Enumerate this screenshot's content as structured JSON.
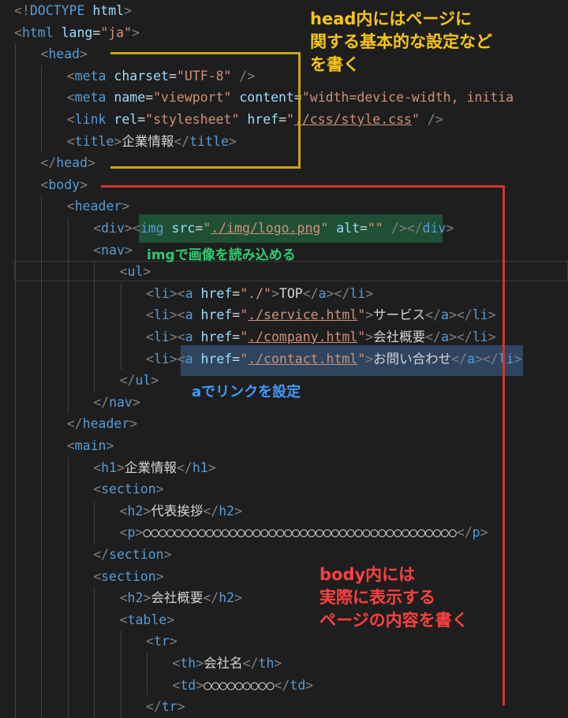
{
  "lines": [
    {
      "indent": 0,
      "tokens": [
        {
          "t": "<!",
          "c": "punct"
        },
        {
          "t": "DOCTYPE",
          "c": "kw"
        },
        {
          "t": " html",
          "c": "attr"
        },
        {
          "t": ">",
          "c": "punct"
        }
      ]
    },
    {
      "indent": 0,
      "tokens": [
        {
          "t": "<",
          "c": "punct"
        },
        {
          "t": "html",
          "c": "tag"
        },
        {
          "t": " lang",
          "c": "attr"
        },
        {
          "t": "=",
          "c": "txt"
        },
        {
          "t": "\"ja\"",
          "c": "str"
        },
        {
          "t": ">",
          "c": "punct"
        }
      ]
    },
    {
      "indent": 1,
      "tokens": [
        {
          "t": "<",
          "c": "punct"
        },
        {
          "t": "head",
          "c": "tag"
        },
        {
          "t": ">",
          "c": "punct"
        }
      ]
    },
    {
      "indent": 2,
      "tokens": [
        {
          "t": "<",
          "c": "punct"
        },
        {
          "t": "meta",
          "c": "tag"
        },
        {
          "t": " charset",
          "c": "attr"
        },
        {
          "t": "=",
          "c": "txt"
        },
        {
          "t": "\"UTF-8\"",
          "c": "str"
        },
        {
          "t": " />",
          "c": "punct"
        }
      ]
    },
    {
      "indent": 2,
      "tokens": [
        {
          "t": "<",
          "c": "punct"
        },
        {
          "t": "meta",
          "c": "tag"
        },
        {
          "t": " name",
          "c": "attr"
        },
        {
          "t": "=",
          "c": "txt"
        },
        {
          "t": "\"viewport\"",
          "c": "str"
        },
        {
          "t": " content",
          "c": "attr"
        },
        {
          "t": "=",
          "c": "txt"
        },
        {
          "t": "\"width=device-width, initia",
          "c": "str"
        }
      ]
    },
    {
      "indent": 2,
      "tokens": [
        {
          "t": "<",
          "c": "punct"
        },
        {
          "t": "link",
          "c": "tag"
        },
        {
          "t": " rel",
          "c": "attr"
        },
        {
          "t": "=",
          "c": "txt"
        },
        {
          "t": "\"stylesheet\"",
          "c": "str"
        },
        {
          "t": " href",
          "c": "attr"
        },
        {
          "t": "=",
          "c": "txt"
        },
        {
          "t": "\"",
          "c": "str"
        },
        {
          "t": "./css/style.css",
          "c": "url"
        },
        {
          "t": "\"",
          "c": "str"
        },
        {
          "t": " />",
          "c": "punct"
        }
      ]
    },
    {
      "indent": 2,
      "tokens": [
        {
          "t": "<",
          "c": "punct"
        },
        {
          "t": "title",
          "c": "tag"
        },
        {
          "t": ">",
          "c": "punct"
        },
        {
          "t": "企業情報",
          "c": "txt"
        },
        {
          "t": "</",
          "c": "punct"
        },
        {
          "t": "title",
          "c": "tag"
        },
        {
          "t": ">",
          "c": "punct"
        }
      ]
    },
    {
      "indent": 1,
      "tokens": [
        {
          "t": "</",
          "c": "punct"
        },
        {
          "t": "head",
          "c": "tag"
        },
        {
          "t": ">",
          "c": "punct"
        }
      ]
    },
    {
      "indent": 1,
      "tokens": [
        {
          "t": "<",
          "c": "punct"
        },
        {
          "t": "body",
          "c": "tag"
        },
        {
          "t": ">",
          "c": "punct"
        }
      ]
    },
    {
      "indent": 2,
      "tokens": [
        {
          "t": "<",
          "c": "punct"
        },
        {
          "t": "header",
          "c": "tag"
        },
        {
          "t": ">",
          "c": "punct"
        }
      ]
    },
    {
      "indent": 3,
      "tokens": [
        {
          "t": "<",
          "c": "punct"
        },
        {
          "t": "div",
          "c": "tag"
        },
        {
          "t": ">",
          "c": "punct"
        },
        {
          "t": "<",
          "c": "punct"
        },
        {
          "t": "img",
          "c": "tag"
        },
        {
          "t": " src",
          "c": "attr"
        },
        {
          "t": "=",
          "c": "txt"
        },
        {
          "t": "\"",
          "c": "str"
        },
        {
          "t": "./img/logo.png",
          "c": "url"
        },
        {
          "t": "\"",
          "c": "str"
        },
        {
          "t": " alt",
          "c": "attr"
        },
        {
          "t": "=",
          "c": "txt"
        },
        {
          "t": "\"\"",
          "c": "str"
        },
        {
          "t": " />",
          "c": "punct"
        },
        {
          "t": "</",
          "c": "punct"
        },
        {
          "t": "div",
          "c": "tag"
        },
        {
          "t": ">",
          "c": "punct"
        }
      ]
    },
    {
      "indent": 3,
      "tokens": [
        {
          "t": "<",
          "c": "punct"
        },
        {
          "t": "nav",
          "c": "tag"
        },
        {
          "t": ">",
          "c": "punct"
        }
      ]
    },
    {
      "indent": 4,
      "tokens": [
        {
          "t": "<",
          "c": "punct"
        },
        {
          "t": "ul",
          "c": "tag"
        },
        {
          "t": ">",
          "c": "punct"
        }
      ]
    },
    {
      "indent": 5,
      "tokens": [
        {
          "t": "<",
          "c": "punct"
        },
        {
          "t": "li",
          "c": "tag"
        },
        {
          "t": ">",
          "c": "punct"
        },
        {
          "t": "<",
          "c": "punct"
        },
        {
          "t": "a",
          "c": "tag"
        },
        {
          "t": " href",
          "c": "attr"
        },
        {
          "t": "=",
          "c": "txt"
        },
        {
          "t": "\"./\"",
          "c": "str"
        },
        {
          "t": ">",
          "c": "punct"
        },
        {
          "t": "TOP",
          "c": "txt"
        },
        {
          "t": "</",
          "c": "punct"
        },
        {
          "t": "a",
          "c": "tag"
        },
        {
          "t": ">",
          "c": "punct"
        },
        {
          "t": "</",
          "c": "punct"
        },
        {
          "t": "li",
          "c": "tag"
        },
        {
          "t": ">",
          "c": "punct"
        }
      ]
    },
    {
      "indent": 5,
      "tokens": [
        {
          "t": "<",
          "c": "punct"
        },
        {
          "t": "li",
          "c": "tag"
        },
        {
          "t": ">",
          "c": "punct"
        },
        {
          "t": "<",
          "c": "punct"
        },
        {
          "t": "a",
          "c": "tag"
        },
        {
          "t": " href",
          "c": "attr"
        },
        {
          "t": "=",
          "c": "txt"
        },
        {
          "t": "\"",
          "c": "str"
        },
        {
          "t": "./service.html",
          "c": "url"
        },
        {
          "t": "\"",
          "c": "str"
        },
        {
          "t": ">",
          "c": "punct"
        },
        {
          "t": "サービス",
          "c": "txt"
        },
        {
          "t": "</",
          "c": "punct"
        },
        {
          "t": "a",
          "c": "tag"
        },
        {
          "t": ">",
          "c": "punct"
        },
        {
          "t": "</",
          "c": "punct"
        },
        {
          "t": "li",
          "c": "tag"
        },
        {
          "t": ">",
          "c": "punct"
        }
      ]
    },
    {
      "indent": 5,
      "tokens": [
        {
          "t": "<",
          "c": "punct"
        },
        {
          "t": "li",
          "c": "tag"
        },
        {
          "t": ">",
          "c": "punct"
        },
        {
          "t": "<",
          "c": "punct"
        },
        {
          "t": "a",
          "c": "tag"
        },
        {
          "t": " href",
          "c": "attr"
        },
        {
          "t": "=",
          "c": "txt"
        },
        {
          "t": "\"",
          "c": "str"
        },
        {
          "t": "./company.html",
          "c": "url"
        },
        {
          "t": "\"",
          "c": "str"
        },
        {
          "t": ">",
          "c": "punct"
        },
        {
          "t": "会社概要",
          "c": "txt"
        },
        {
          "t": "</",
          "c": "punct"
        },
        {
          "t": "a",
          "c": "tag"
        },
        {
          "t": ">",
          "c": "punct"
        },
        {
          "t": "</",
          "c": "punct"
        },
        {
          "t": "li",
          "c": "tag"
        },
        {
          "t": ">",
          "c": "punct"
        }
      ]
    },
    {
      "indent": 5,
      "tokens": [
        {
          "t": "<",
          "c": "punct"
        },
        {
          "t": "li",
          "c": "tag"
        },
        {
          "t": ">",
          "c": "punct"
        },
        {
          "t": "<",
          "c": "punct"
        },
        {
          "t": "a",
          "c": "tag"
        },
        {
          "t": " href",
          "c": "attr"
        },
        {
          "t": "=",
          "c": "txt"
        },
        {
          "t": "\"",
          "c": "str"
        },
        {
          "t": "./contact.html",
          "c": "url"
        },
        {
          "t": "\"",
          "c": "str"
        },
        {
          "t": ">",
          "c": "punct"
        },
        {
          "t": "お問い合わせ",
          "c": "txt"
        },
        {
          "t": "</",
          "c": "punct"
        },
        {
          "t": "a",
          "c": "tag"
        },
        {
          "t": ">",
          "c": "punct"
        },
        {
          "t": "</",
          "c": "punct"
        },
        {
          "t": "li",
          "c": "tag"
        },
        {
          "t": ">",
          "c": "punct"
        }
      ]
    },
    {
      "indent": 4,
      "tokens": [
        {
          "t": "</",
          "c": "punct"
        },
        {
          "t": "ul",
          "c": "tag"
        },
        {
          "t": ">",
          "c": "punct"
        }
      ]
    },
    {
      "indent": 3,
      "tokens": [
        {
          "t": "</",
          "c": "punct"
        },
        {
          "t": "nav",
          "c": "tag"
        },
        {
          "t": ">",
          "c": "punct"
        }
      ]
    },
    {
      "indent": 2,
      "tokens": [
        {
          "t": "</",
          "c": "punct"
        },
        {
          "t": "header",
          "c": "tag"
        },
        {
          "t": ">",
          "c": "punct"
        }
      ]
    },
    {
      "indent": 2,
      "tokens": [
        {
          "t": "<",
          "c": "punct"
        },
        {
          "t": "main",
          "c": "tag"
        },
        {
          "t": ">",
          "c": "punct"
        }
      ]
    },
    {
      "indent": 3,
      "tokens": [
        {
          "t": "<",
          "c": "punct"
        },
        {
          "t": "h1",
          "c": "tag"
        },
        {
          "t": ">",
          "c": "punct"
        },
        {
          "t": "企業情報",
          "c": "txt"
        },
        {
          "t": "</",
          "c": "punct"
        },
        {
          "t": "h1",
          "c": "tag"
        },
        {
          "t": ">",
          "c": "punct"
        }
      ]
    },
    {
      "indent": 3,
      "tokens": [
        {
          "t": "<",
          "c": "punct"
        },
        {
          "t": "section",
          "c": "tag"
        },
        {
          "t": ">",
          "c": "punct"
        }
      ]
    },
    {
      "indent": 4,
      "tokens": [
        {
          "t": "<",
          "c": "punct"
        },
        {
          "t": "h2",
          "c": "tag"
        },
        {
          "t": ">",
          "c": "punct"
        },
        {
          "t": "代表挨拶",
          "c": "txt"
        },
        {
          "t": "</",
          "c": "punct"
        },
        {
          "t": "h2",
          "c": "tag"
        },
        {
          "t": ">",
          "c": "punct"
        }
      ]
    },
    {
      "indent": 4,
      "tokens": [
        {
          "t": "<",
          "c": "punct"
        },
        {
          "t": "p",
          "c": "tag"
        },
        {
          "t": ">",
          "c": "punct"
        },
        {
          "t": "○○○○○○○○○○○○○○○○○○○○○○○○○○○○○○○○○○○○○○○○",
          "c": "txt"
        },
        {
          "t": "</",
          "c": "punct"
        },
        {
          "t": "p",
          "c": "tag"
        },
        {
          "t": ">",
          "c": "punct"
        }
      ]
    },
    {
      "indent": 3,
      "tokens": [
        {
          "t": "</",
          "c": "punct"
        },
        {
          "t": "section",
          "c": "tag"
        },
        {
          "t": ">",
          "c": "punct"
        }
      ]
    },
    {
      "indent": 3,
      "tokens": [
        {
          "t": "<",
          "c": "punct"
        },
        {
          "t": "section",
          "c": "tag"
        },
        {
          "t": ">",
          "c": "punct"
        }
      ]
    },
    {
      "indent": 4,
      "tokens": [
        {
          "t": "<",
          "c": "punct"
        },
        {
          "t": "h2",
          "c": "tag"
        },
        {
          "t": ">",
          "c": "punct"
        },
        {
          "t": "会社概要",
          "c": "txt"
        },
        {
          "t": "</",
          "c": "punct"
        },
        {
          "t": "h2",
          "c": "tag"
        },
        {
          "t": ">",
          "c": "punct"
        }
      ]
    },
    {
      "indent": 4,
      "tokens": [
        {
          "t": "<",
          "c": "punct"
        },
        {
          "t": "table",
          "c": "tag"
        },
        {
          "t": ">",
          "c": "punct"
        }
      ]
    },
    {
      "indent": 5,
      "tokens": [
        {
          "t": "<",
          "c": "punct"
        },
        {
          "t": "tr",
          "c": "tag"
        },
        {
          "t": ">",
          "c": "punct"
        }
      ]
    },
    {
      "indent": 6,
      "tokens": [
        {
          "t": "<",
          "c": "punct"
        },
        {
          "t": "th",
          "c": "tag"
        },
        {
          "t": ">",
          "c": "punct"
        },
        {
          "t": "会社名",
          "c": "txt"
        },
        {
          "t": "</",
          "c": "punct"
        },
        {
          "t": "th",
          "c": "tag"
        },
        {
          "t": ">",
          "c": "punct"
        }
      ]
    },
    {
      "indent": 6,
      "tokens": [
        {
          "t": "<",
          "c": "punct"
        },
        {
          "t": "td",
          "c": "tag"
        },
        {
          "t": ">",
          "c": "punct"
        },
        {
          "t": "○○○○○○○○○",
          "c": "txt"
        },
        {
          "t": "</",
          "c": "punct"
        },
        {
          "t": "td",
          "c": "tag"
        },
        {
          "t": ">",
          "c": "punct"
        }
      ]
    },
    {
      "indent": 5,
      "tokens": [
        {
          "t": "</",
          "c": "punct"
        },
        {
          "t": "tr",
          "c": "tag"
        },
        {
          "t": ">",
          "c": "punct"
        }
      ]
    }
  ],
  "annotations": {
    "head_note": "head内にはページに\n関する基本的な設定など\nを書く",
    "img_note": "imgで画像を読み込める",
    "a_note": "aでリンクを設定",
    "body_note": "body内には\n実際に表示する\nページの内容を書く"
  },
  "colors": {
    "background": "#1e1e1e",
    "tag": "#569cd6",
    "attribute": "#9cdcfe",
    "string": "#ce9178",
    "head_annotation": "#f5c518",
    "img_annotation": "#2ecc71",
    "a_annotation": "#3d9bff",
    "body_annotation": "#ff4040"
  }
}
